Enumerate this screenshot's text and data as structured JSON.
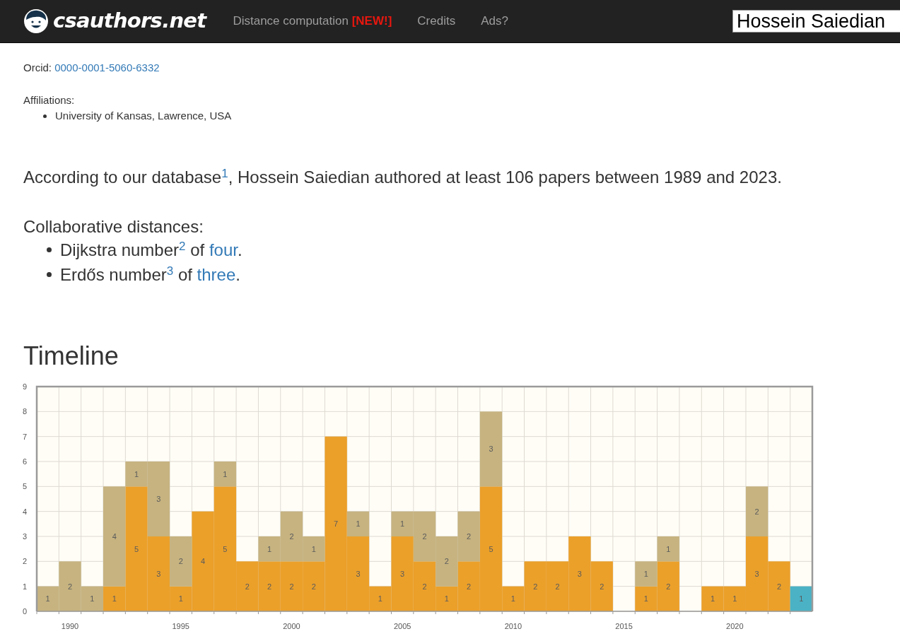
{
  "navbar": {
    "brand": "csauthors.net",
    "links": [
      {
        "label": "Distance computation",
        "badge": "[NEW!]"
      },
      {
        "label": "Credits"
      },
      {
        "label": "Ads?"
      }
    ],
    "search": {
      "value": "Hossein Saiedian"
    }
  },
  "profile": {
    "orcid_label": "Orcid:",
    "orcid": "0000-0001-5060-6332",
    "affiliations_label": "Affiliations:",
    "affiliations": [
      "University of Kansas, Lawrence, USA"
    ]
  },
  "summary": "According to our database$^{1}$, Hossein Saiedian authored at least 106 papers between 1989 and 2023.",
  "distances": {
    "title": "Collaborative distances:",
    "items": [
      {
        "text": "Dijkstra number$^{2}$ of",
        "link": "four",
        "suffix": "."
      },
      {
        "text": "Erdős number$^{3}$ of",
        "link": "three",
        "suffix": "."
      }
    ]
  },
  "timeline": {
    "title": "Timeline",
    "chart_data": {
      "type": "bar",
      "stacked": true,
      "data_labels": true,
      "grid": true,
      "x": [
        1989,
        1990,
        1991,
        1992,
        1993,
        1994,
        1995,
        1996,
        1997,
        1998,
        1999,
        2000,
        2001,
        2002,
        2003,
        2004,
        2005,
        2006,
        2007,
        2008,
        2009,
        2010,
        2011,
        2012,
        2013,
        2014,
        2015,
        2016,
        2017,
        2018,
        2019,
        2020,
        2021,
        2022,
        2023
      ],
      "series": [
        {
          "color": "#eba02a",
          "values": [
            null,
            null,
            null,
            1,
            5,
            3,
            1,
            4,
            5,
            2,
            2,
            2,
            2,
            7,
            3,
            1,
            3,
            2,
            1,
            2,
            5,
            1,
            2,
            2,
            3,
            2,
            null,
            1,
            2,
            null,
            1,
            1,
            3,
            2,
            null
          ]
        },
        {
          "color": "#c6b380",
          "values": [
            1,
            2,
            1,
            4,
            1,
            3,
            2,
            null,
            1,
            null,
            1,
            2,
            1,
            null,
            1,
            null,
            1,
            2,
            2,
            2,
            3,
            null,
            null,
            null,
            null,
            null,
            null,
            1,
            1,
            null,
            null,
            null,
            2,
            null,
            null
          ]
        },
        {
          "color": "#4bb2c5",
          "values": [
            null,
            null,
            null,
            null,
            null,
            null,
            null,
            null,
            null,
            null,
            null,
            null,
            null,
            null,
            null,
            null,
            null,
            null,
            null,
            null,
            null,
            null,
            null,
            null,
            null,
            null,
            null,
            null,
            null,
            null,
            null,
            null,
            null,
            null,
            1
          ]
        }
      ],
      "xlim": [
        1988.5,
        2023.5
      ],
      "ylim": [
        0,
        9
      ],
      "yticks": [
        0,
        1,
        2,
        3,
        4,
        5,
        6,
        7,
        8,
        9
      ],
      "xticks": [
        1990,
        1995,
        2000,
        2005,
        2010,
        2015,
        2020
      ]
    }
  }
}
